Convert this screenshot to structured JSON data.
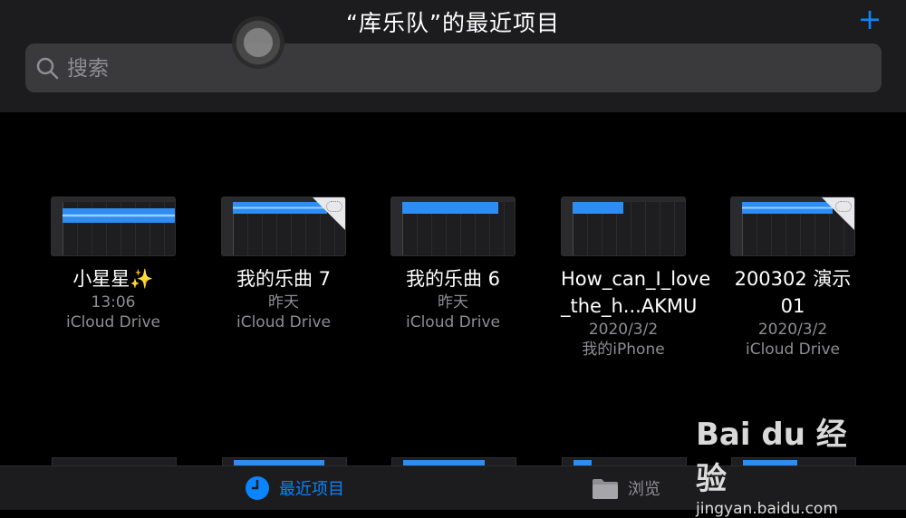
{
  "header": {
    "title": "“库乐队”的最近项目",
    "add_label": "+"
  },
  "search": {
    "placeholder": "搜索"
  },
  "items": [
    {
      "name": "小星星✨",
      "date": "13:06",
      "location": "iCloud Drive"
    },
    {
      "name": "我的乐曲 7",
      "date": "昨天",
      "location": "iCloud Drive"
    },
    {
      "name": "我的乐曲 6",
      "date": "昨天",
      "location": "iCloud Drive"
    },
    {
      "name": "How_can_I_love\n_the_h...AKMU",
      "name_line1": "How_can_I_love",
      "name_line2": "_the_h...AKMU",
      "date": "2020/3/2",
      "location": "我的iPhone"
    },
    {
      "name": "200302 演示 01",
      "date": "2020/3/2",
      "location": "iCloud Drive"
    }
  ],
  "tabbar": {
    "recent_label": "最近项目",
    "browse_label": "浏览"
  },
  "colors": {
    "accent": "#0a84ff",
    "background": "#000000",
    "header": "#1c1c1e"
  },
  "watermark": {
    "logo": "Bai du 经验",
    "url": "jingyan.baidu.com"
  }
}
